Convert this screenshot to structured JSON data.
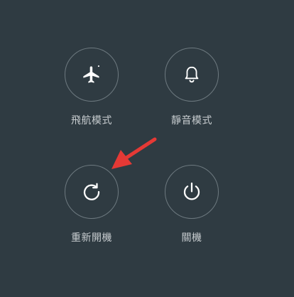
{
  "power_menu": {
    "airplane_mode": {
      "label": "飛航模式",
      "icon": "airplane-icon"
    },
    "silent_mode": {
      "label": "靜音模式",
      "icon": "bell-icon"
    },
    "reboot": {
      "label": "重新開機",
      "icon": "reboot-icon"
    },
    "power_off": {
      "label": "關機",
      "icon": "power-icon"
    }
  },
  "annotation": {
    "arrow_color": "#e53935"
  },
  "colors": {
    "background": "#2f3b42",
    "circle_border": "#6e7a80",
    "label": "#c8cdd0",
    "icon": "#ffffff"
  }
}
